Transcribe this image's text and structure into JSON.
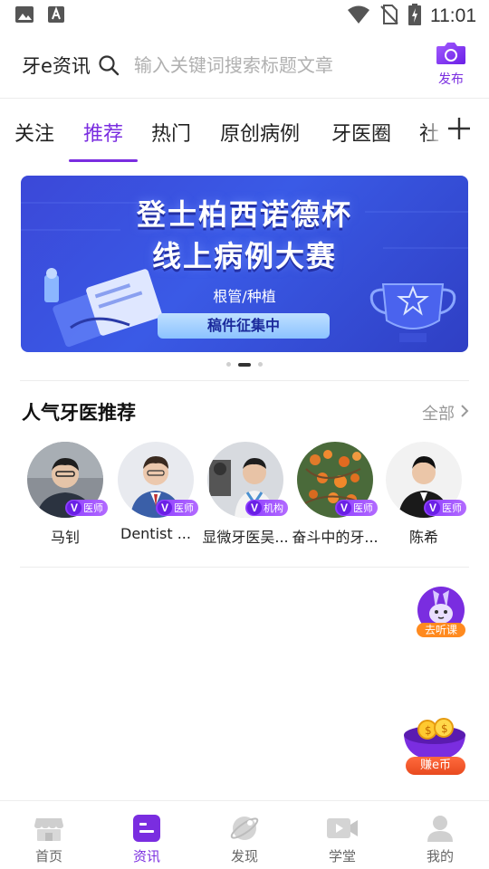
{
  "status_bar": {
    "time": "11:01"
  },
  "header": {
    "app_title": "牙e资讯",
    "search_placeholder": "输入关键词搜索标题文章",
    "publish_label": "发布"
  },
  "tabs": [
    {
      "label": "关注"
    },
    {
      "label": "推荐"
    },
    {
      "label": "热门"
    },
    {
      "label": "原创病例"
    },
    {
      "label": "牙医圈"
    },
    {
      "label": "社"
    }
  ],
  "banner": {
    "title_line1": "登士柏西诺德杯",
    "title_line2": "线上病例大赛",
    "subtitle": "根管/种植",
    "button": "稿件征集中"
  },
  "recommend": {
    "title": "人气牙医推荐",
    "see_all": "全部",
    "dentists": [
      {
        "name": "马钊",
        "badge": "医师"
      },
      {
        "name": "Dentist ...",
        "badge": "医师"
      },
      {
        "name": "显微牙医吴...",
        "badge": "机构"
      },
      {
        "name": "奋斗中的牙...",
        "badge": "医师"
      },
      {
        "name": "陈希",
        "badge": "医师"
      }
    ]
  },
  "floats": {
    "listen": "去听课",
    "earn": "赚e币"
  },
  "bottom_nav": [
    {
      "label": "首页",
      "icon": "home-icon"
    },
    {
      "label": "资讯",
      "icon": "news-icon"
    },
    {
      "label": "发现",
      "icon": "discover-icon"
    },
    {
      "label": "学堂",
      "icon": "video-icon"
    },
    {
      "label": "我的",
      "icon": "profile-icon"
    }
  ],
  "colors": {
    "accent": "#7a2de0",
    "banner": "#3a4fe0"
  }
}
